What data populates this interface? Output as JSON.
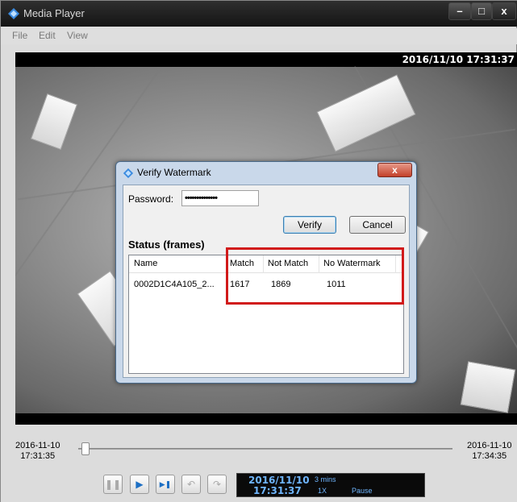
{
  "window": {
    "title": "Media Player",
    "controls": {
      "minimize": "–",
      "maximize": "□",
      "close": "x"
    }
  },
  "menu": [
    "File",
    "Edit",
    "View"
  ],
  "video": {
    "timestamp": "2016/11/10 17:31:37"
  },
  "dialog": {
    "title": "Verify Watermark",
    "close_label": "x",
    "password_label": "Password:",
    "password_value": "••••••••••••••",
    "verify_label": "Verify",
    "cancel_label": "Cancel",
    "status_label": "Status (frames)",
    "columns": [
      "Name",
      "Match",
      "Not Match",
      "No Watermark"
    ],
    "rows": [
      {
        "name": "0002D1C4A105_2...",
        "match": "1617",
        "not_match": "1869",
        "no_watermark": "1011"
      }
    ],
    "highlight_color": "#d11a1a"
  },
  "timeline": {
    "start_date": "2016-11-10",
    "start_time": "17:31:35",
    "end_date": "2016-11-10",
    "end_time": "17:34:35",
    "position_fraction": 0.02
  },
  "playback": {
    "buttons": [
      {
        "name": "pause",
        "icon": "pause-icon",
        "glyph": "❚❚",
        "enabled": false
      },
      {
        "name": "play",
        "icon": "play-icon",
        "glyph": "▶",
        "enabled": true
      },
      {
        "name": "step-forward",
        "icon": "step-forward-icon",
        "glyph": "▶❚",
        "enabled": true
      },
      {
        "name": "rewind",
        "icon": "rewind-icon",
        "glyph": "↶",
        "enabled": false
      },
      {
        "name": "forward",
        "icon": "fast-forward-icon",
        "glyph": "↷",
        "enabled": false
      }
    ],
    "date": "2016/11/10",
    "time": "17:31:37",
    "duration": "3 mins",
    "speed": "1X",
    "state": "Pause"
  }
}
